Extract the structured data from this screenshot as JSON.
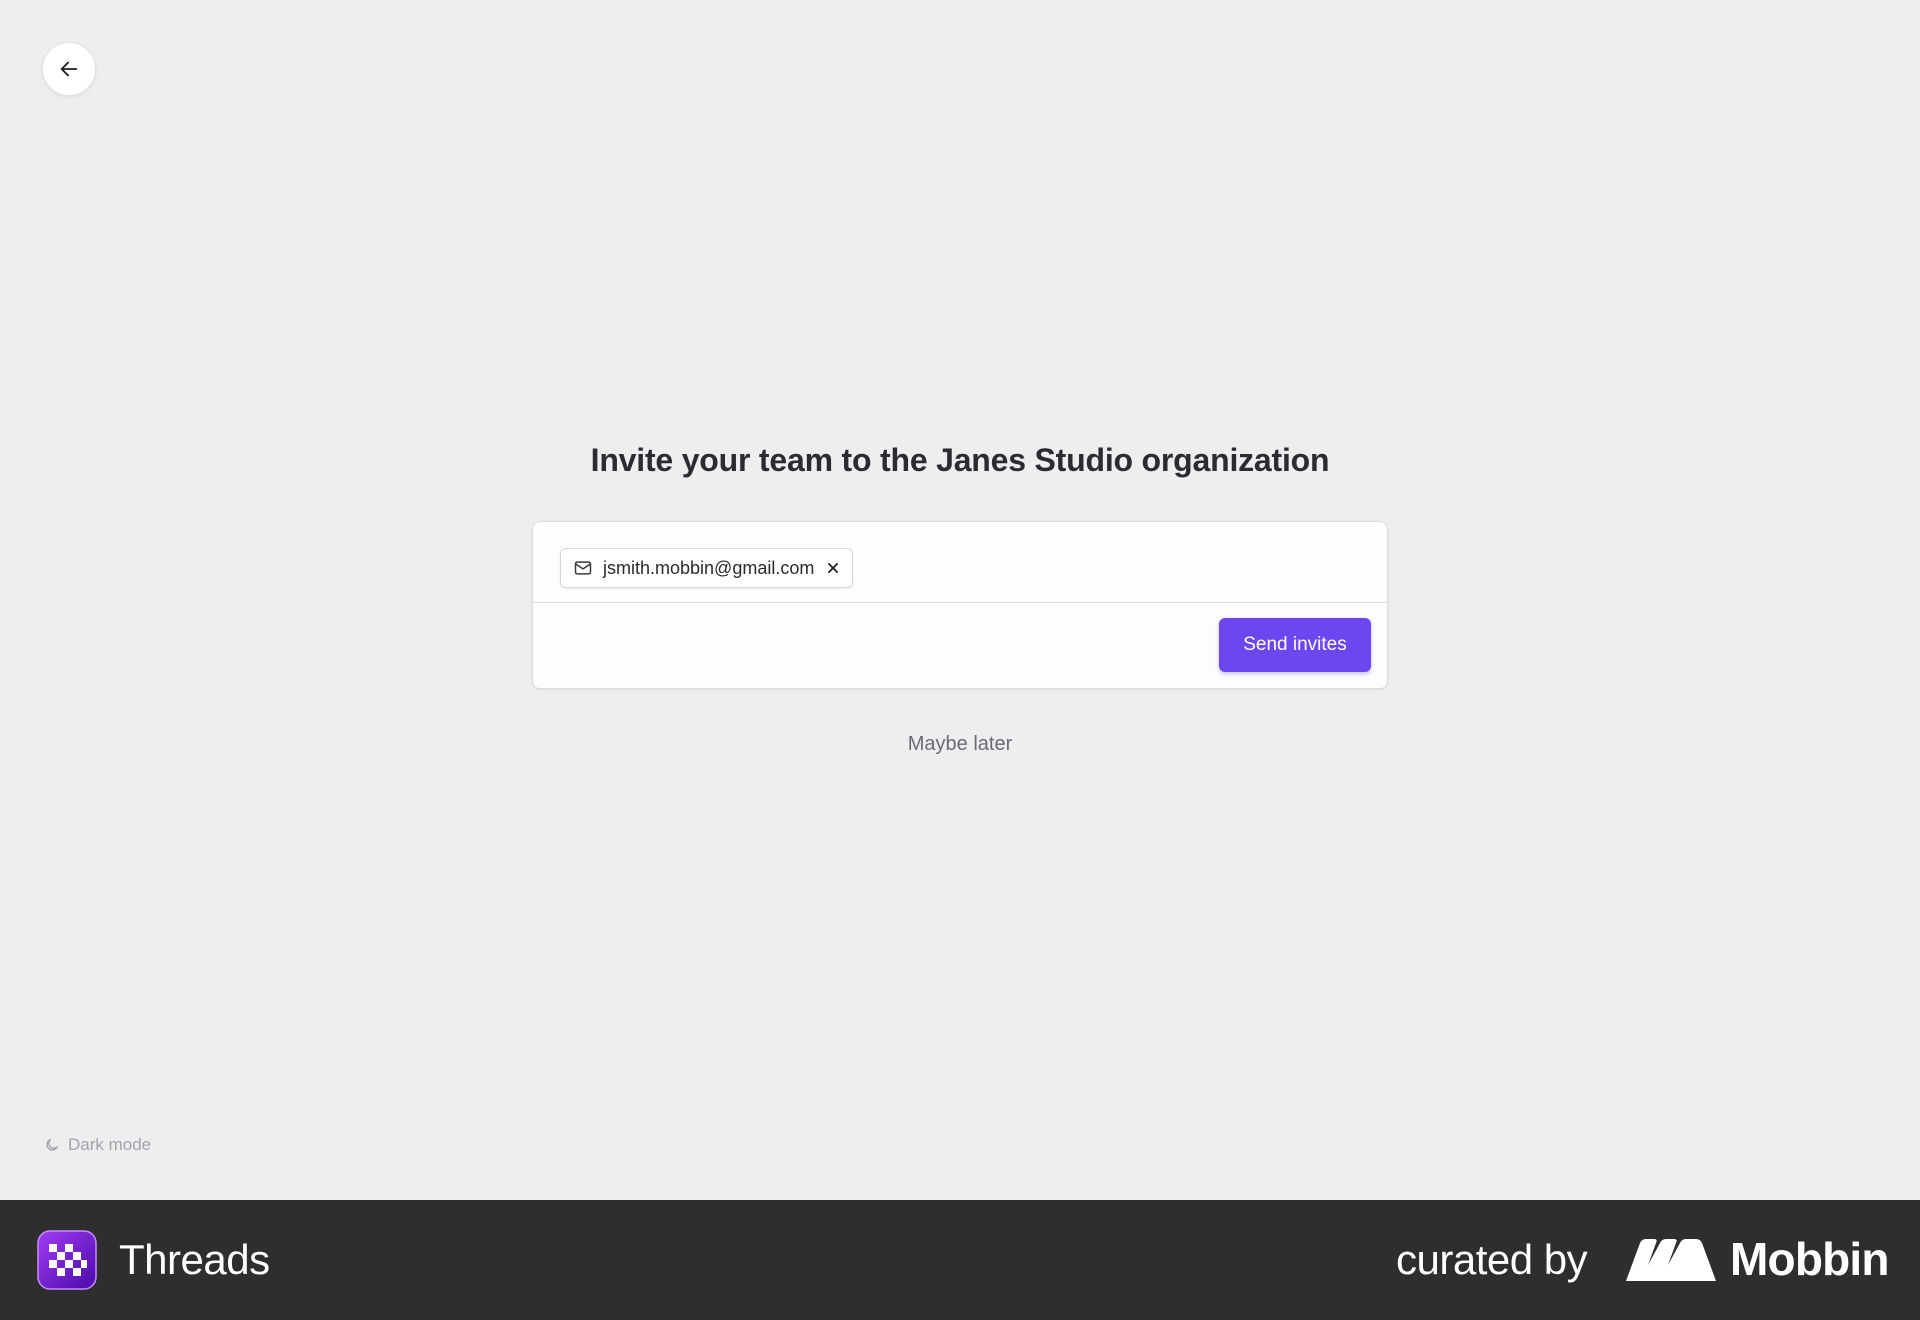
{
  "page": {
    "title": "Invite your team to the Janes Studio organization"
  },
  "invite": {
    "chips": [
      {
        "email": "jsmith.mobbin@gmail.com"
      }
    ],
    "send_label": "Send invites",
    "skip_label": "Maybe later"
  },
  "theme_toggle": {
    "label": "Dark mode"
  },
  "footer": {
    "app_name": "Threads",
    "curated_by": "curated by",
    "brand": "Mobbin"
  },
  "colors": {
    "background": "#edeef0",
    "accent": "#6c47f0",
    "footer": "#2e2e2e"
  },
  "icons": {
    "back": "arrow-left-icon",
    "chip": "mail-icon",
    "chip_remove": "close-icon",
    "theme": "moon-icon"
  }
}
